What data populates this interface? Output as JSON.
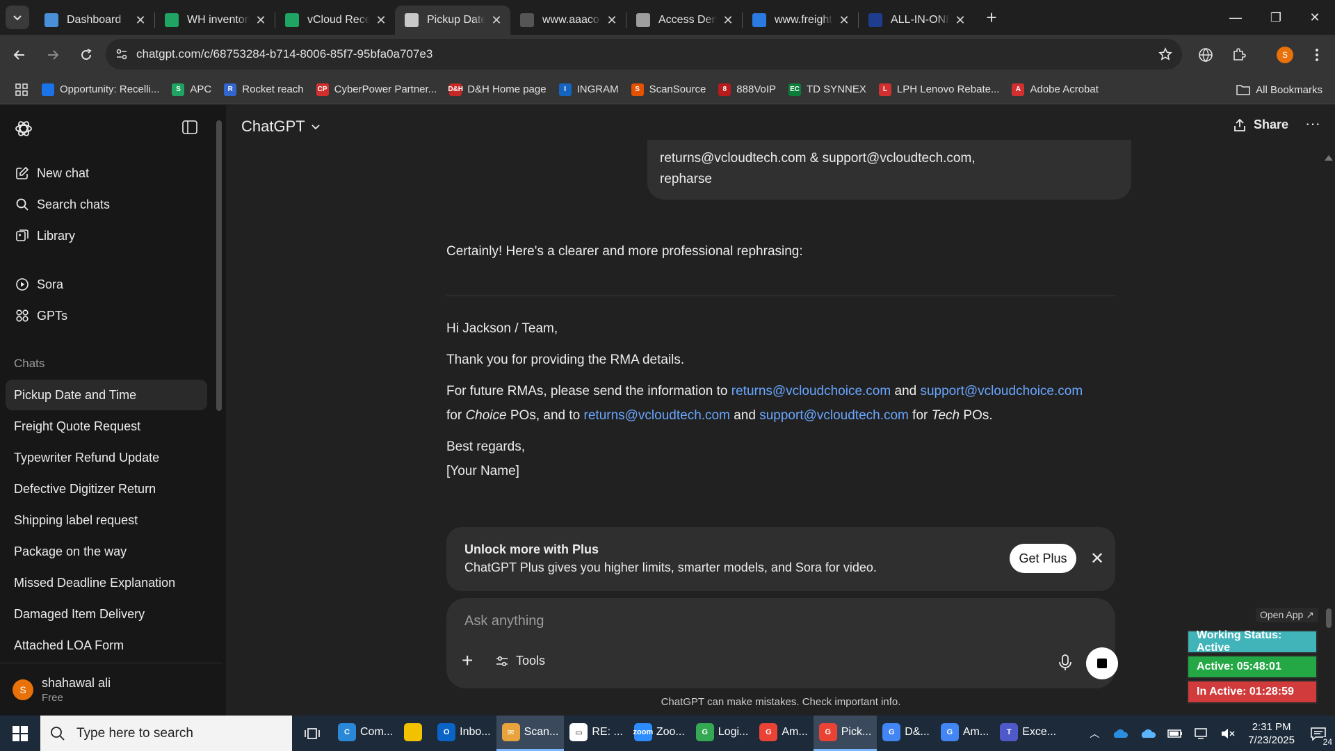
{
  "browser": {
    "tabs": [
      {
        "title": "Dashboard",
        "icon": "dashboard-icon",
        "color": "#4a90d9",
        "active": false
      },
      {
        "title": "WH inventory - G",
        "icon": "sheets-icon",
        "color": "#1fa463",
        "active": false
      },
      {
        "title": "vCloud Receive F",
        "icon": "sheets-icon",
        "color": "#1fa463",
        "active": false
      },
      {
        "title": "Pickup Date and",
        "icon": "openai-icon",
        "color": "#c9c9c9",
        "active": true
      },
      {
        "title": "www.aaacooper.",
        "icon": "aaa-cooper-icon",
        "color": "#555555",
        "active": false
      },
      {
        "title": "Access Denied",
        "icon": "globe-icon",
        "color": "#9e9e9e",
        "active": false
      },
      {
        "title": "www.freightclass",
        "icon": "fcc-icon",
        "color": "#2a7ae2",
        "active": false
      },
      {
        "title": "ALL-IN-ONE PAC",
        "icon": "t7-icon",
        "color": "#1e3d8f",
        "active": false
      }
    ],
    "url": "chatgpt.com/c/68753284-b714-8006-85f7-95bfa0a707e3",
    "profile_initial": "S",
    "bookmarks": [
      {
        "label": "Opportunity: Recelli...",
        "color": "#1a73e8",
        "mark": ""
      },
      {
        "label": "APC",
        "color": "#1fa463",
        "mark": "S"
      },
      {
        "label": "Rocket reach",
        "color": "#3366cc",
        "mark": "R"
      },
      {
        "label": "CyberPower Partner...",
        "color": "#d32f2f",
        "mark": "CP"
      },
      {
        "label": "D&H Home page",
        "color": "#c62828",
        "mark": "D&H"
      },
      {
        "label": "INGRAM",
        "color": "#1565c0",
        "mark": "I"
      },
      {
        "label": "ScanSource",
        "color": "#e65100",
        "mark": "S"
      },
      {
        "label": "888VoIP",
        "color": "#b71c1c",
        "mark": "8"
      },
      {
        "label": "TD SYNNEX",
        "color": "#0a7d3b",
        "mark": "EC"
      },
      {
        "label": "LPH Lenovo Rebate...",
        "color": "#d32f2f",
        "mark": "L"
      },
      {
        "label": "Adobe Acrobat",
        "color": "#d32f2f",
        "mark": "A"
      }
    ],
    "all_bookmarks_label": "All Bookmarks"
  },
  "sidebar": {
    "new_chat": "New chat",
    "search_chats": "Search chats",
    "library": "Library",
    "sora": "Sora",
    "gpts": "GPTs",
    "chats_heading": "Chats",
    "chats": [
      "Pickup Date and Time",
      "Freight Quote Request",
      "Typewriter Refund Update",
      "Defective Digitizer Return",
      "Shipping label request",
      "Package on the way",
      "Missed Deadline Explanation",
      "Damaged Item Delivery",
      "Attached LOA Form"
    ],
    "user": {
      "name": "shahawal ali",
      "plan": "Free",
      "initial": "S"
    }
  },
  "main": {
    "model": "ChatGPT",
    "share_label": "Share",
    "user_message_line1": "returns@vcloudtech.com & support@vcloudtech.com,",
    "user_message_line2": "repharse",
    "assistant_intro": "Certainly! Here's a clearer and more professional rephrasing:",
    "email": {
      "greeting": "Hi Jackson / Team,",
      "thanks": "Thank you for providing the RMA details.",
      "line1_prefix": "For future RMAs, please send the information to ",
      "email_a": "returns@vcloudchoice.com",
      "and1": " and ",
      "email_b": "support@vcloudchoice.com",
      "line2_for": "for ",
      "choice": "Choice",
      "line2_mid": " POs, and to ",
      "email_c": "returns@vcloudtech.com",
      "and2": " and ",
      "email_d": "support@vcloudtech.com",
      "line2_for2": " for ",
      "tech": "Tech",
      "line2_end": " POs.",
      "closing": "Best regards,",
      "signature": "[Your Name]"
    },
    "plus_card": {
      "title": "Unlock more with Plus",
      "body": "ChatGPT Plus gives you higher limits, smarter models, and Sora for video.",
      "button": "Get Plus"
    },
    "composer": {
      "placeholder": "Ask anything",
      "tools_label": "Tools"
    },
    "disclaimer": "ChatGPT can make mistakes. Check important info."
  },
  "status_widget": {
    "open_app": "Open App ↗",
    "working_status": "Working Status: Active",
    "active": "Active: 05:48:01",
    "inactive": "In Active: 01:28:59"
  },
  "taskbar": {
    "search_placeholder": "Type here to search",
    "apps": [
      {
        "label": "Com...",
        "color": "#2b88d8",
        "mark": "C",
        "active": false
      },
      {
        "label": "",
        "color": "#f2c200",
        "mark": "",
        "active": false
      },
      {
        "label": "Inbo...",
        "color": "#0a64c8",
        "mark": "O",
        "active": false
      },
      {
        "label": "Scan...",
        "color": "#e8a33d",
        "mark": "✉",
        "active": true
      },
      {
        "label": "RE: ...",
        "color": "#ffffff",
        "mark": "▭",
        "active": false
      },
      {
        "label": "Zoo...",
        "color": "#2d8cff",
        "mark": "zoom",
        "active": false
      },
      {
        "label": "Logi...",
        "color": "#34a853",
        "mark": "G",
        "active": false
      },
      {
        "label": "Am...",
        "color": "#ea4335",
        "mark": "G",
        "active": false
      },
      {
        "label": "Pick...",
        "color": "#ea4335",
        "mark": "G",
        "active": true
      },
      {
        "label": "D&...",
        "color": "#4285f4",
        "mark": "G",
        "active": false
      },
      {
        "label": "Am...",
        "color": "#4285f4",
        "mark": "G",
        "active": false
      },
      {
        "label": "Exce...",
        "color": "#5059c9",
        "mark": "T",
        "active": false
      }
    ],
    "time": "2:31 PM",
    "date": "7/23/2025",
    "notifications": "24"
  }
}
